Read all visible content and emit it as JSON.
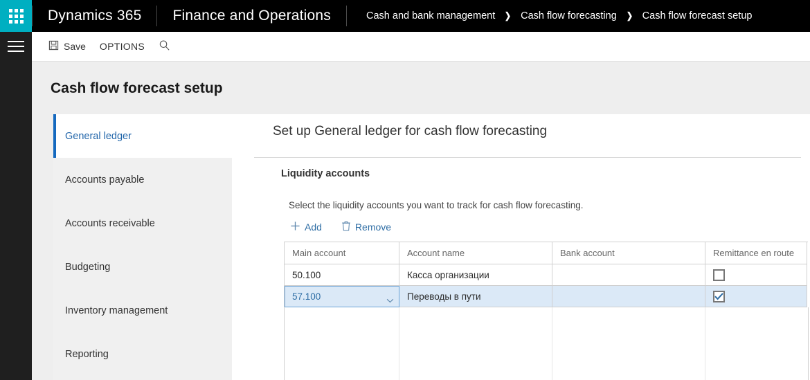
{
  "appbar": {
    "waffle_icon": "waffle-grid-icon",
    "product": "Dynamics 365",
    "module": "Finance and Operations",
    "breadcrumb": [
      "Cash and bank management",
      "Cash flow forecasting",
      "Cash flow forecast setup"
    ],
    "separator": "›",
    "accent_color": "#00AFC1",
    "background_color": "#000000"
  },
  "rail": {
    "menu_icon": "hamburger-icon"
  },
  "toolbar": {
    "save_label": "Save",
    "save_icon": "save-floppy-icon",
    "options_label": "OPTIONS",
    "search_icon": "search-icon"
  },
  "page": {
    "title": "Cash flow forecast setup"
  },
  "nav": {
    "items": [
      {
        "label": "General ledger",
        "selected": true
      },
      {
        "label": "Accounts payable",
        "selected": false
      },
      {
        "label": "Accounts receivable",
        "selected": false
      },
      {
        "label": "Budgeting",
        "selected": false
      },
      {
        "label": "Inventory management",
        "selected": false
      },
      {
        "label": "Reporting",
        "selected": false
      }
    ],
    "selected_accent_color": "#1569bf"
  },
  "content": {
    "heading": "Set up General ledger for cash flow forecasting",
    "section_title": "Liquidity accounts",
    "description": "Select the liquidity accounts you want to track for cash flow forecasting.",
    "grid_toolbar": {
      "add_label": "Add",
      "add_icon": "plus-icon",
      "remove_label": "Remove",
      "remove_icon": "trash-icon"
    },
    "grid": {
      "columns": [
        "Main account",
        "Account name",
        "Bank account",
        "Remittance en route"
      ],
      "rows": [
        {
          "main_account": "50.100",
          "account_name": "Касса организации",
          "bank_account": "",
          "remittance_en_route": false,
          "selected": false
        },
        {
          "main_account": "57.100",
          "account_name": "Переводы в пути",
          "bank_account": "",
          "remittance_en_route": true,
          "selected": true
        }
      ],
      "selected_row_color": "#dbe9f7",
      "active_cell_border_color": "#6ba3d6"
    }
  }
}
